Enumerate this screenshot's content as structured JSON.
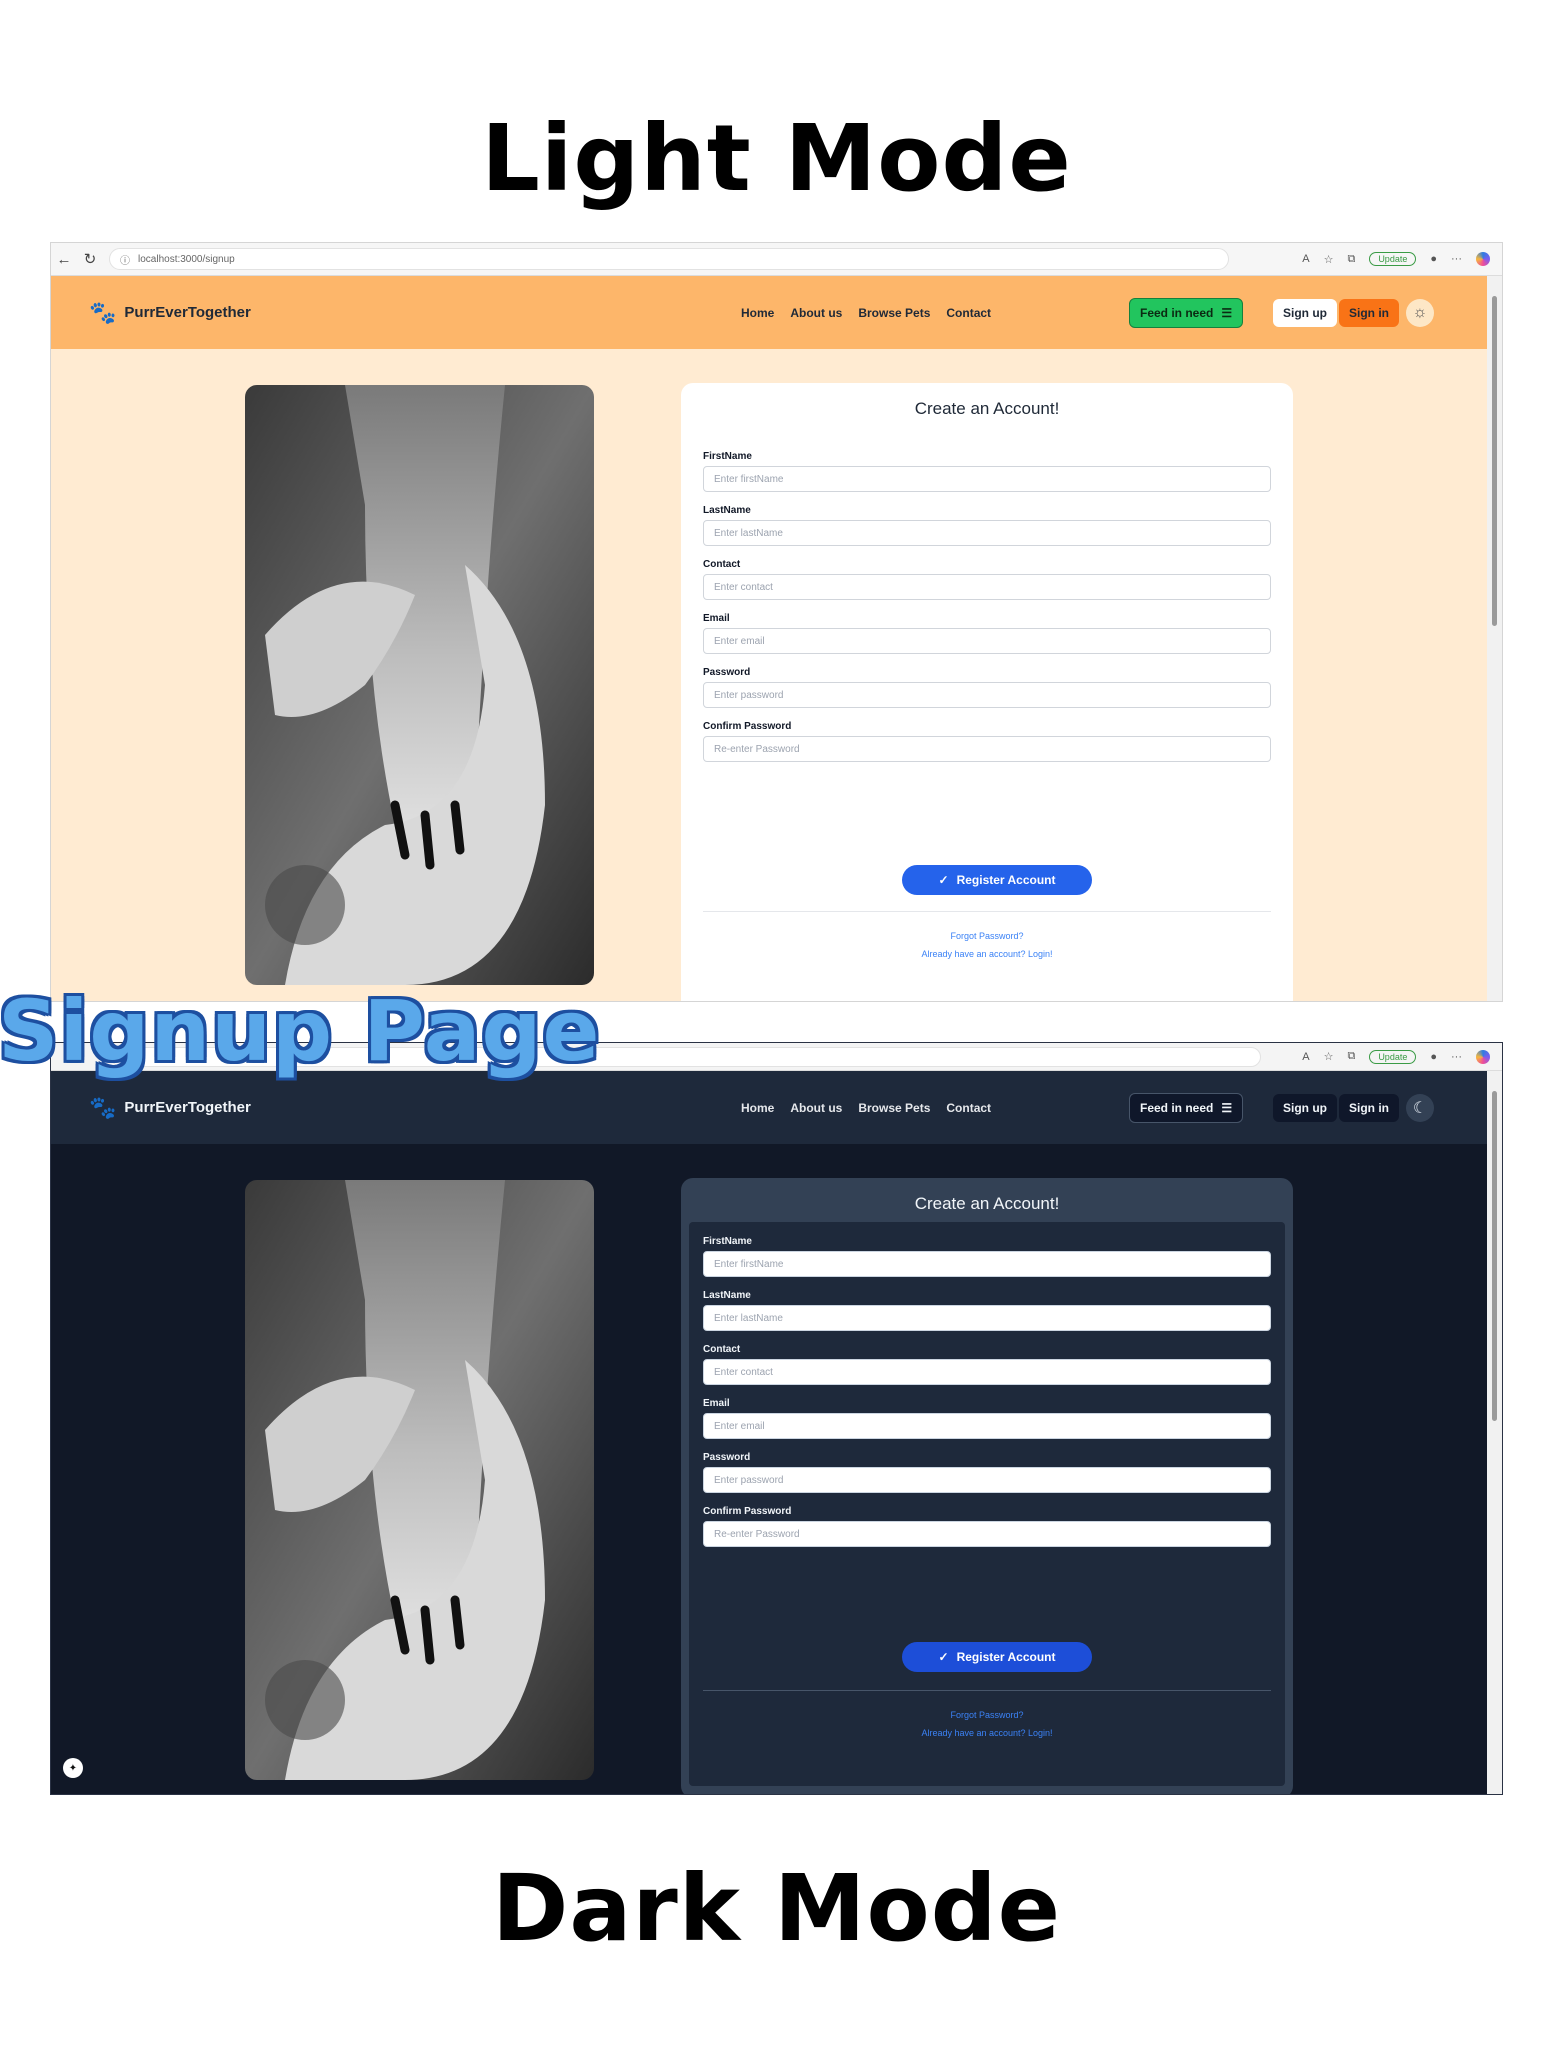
{
  "poster": {
    "light_heading": "Light Mode",
    "dark_heading": "Dark Mode",
    "overlay_title": "Signup Page"
  },
  "browser": {
    "url": "localhost:3000/signup",
    "update_label": "Update"
  },
  "nav": {
    "brand": "PurrEverTogether",
    "links": [
      "Home",
      "About us",
      "Browse Pets",
      "Contact"
    ],
    "feed_label": "Feed in need",
    "signup_label": "Sign up",
    "signin_label": "Sign in"
  },
  "form": {
    "title": "Create an Account!",
    "fields": [
      {
        "label": "FirstName",
        "placeholder": "Enter firstName"
      },
      {
        "label": "LastName",
        "placeholder": "Enter lastName"
      },
      {
        "label": "Contact",
        "placeholder": "Enter contact"
      },
      {
        "label": "Email",
        "placeholder": "Enter email"
      },
      {
        "label": "Password",
        "placeholder": "Enter password"
      },
      {
        "label": "Confirm Password",
        "placeholder": "Re-enter Password"
      }
    ],
    "register_label": "Register Account",
    "forgot_label": "Forgot Password?",
    "login_label": "Already have an account? Login!"
  },
  "colors": {
    "light_nav": "#fdb66a",
    "light_bg": "#ffebd2",
    "dark_nav": "#1e293b",
    "dark_bg": "#111827",
    "accent": "#2563eb"
  }
}
